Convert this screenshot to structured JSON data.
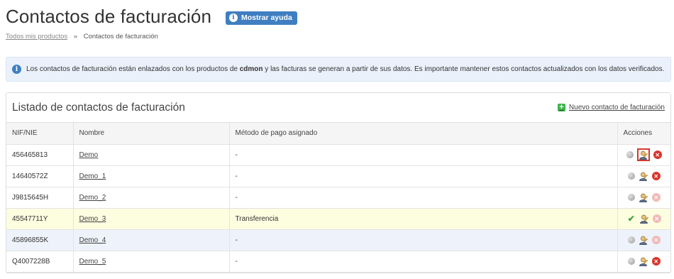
{
  "page": {
    "title": "Contactos de facturación",
    "help_button": "Mostrar ayuda"
  },
  "breadcrumb": {
    "root": "Todos mis productos",
    "separator": "»",
    "current": "Contactos de facturación"
  },
  "info": {
    "text_before": "Los contactos de facturación están enlazados con los productos de ",
    "brand": "cdmon",
    "text_after": " y las facturas se generan a partir de sus datos. Es importante mantener estos contactos actualizados con los datos verificados."
  },
  "panel": {
    "title": "Listado de contactos de facturación",
    "new_link": "Nuevo contacto de facturación"
  },
  "table": {
    "headers": [
      "NIF/NIE",
      "Nombre",
      "Método de pago asignado",
      "Acciones"
    ],
    "rows": [
      {
        "nif": "456465813",
        "name": "Demo",
        "payment": "-",
        "default": false,
        "delete_enabled": true,
        "edit_highlighted": true,
        "style": "normal"
      },
      {
        "nif": "14640572Z",
        "name": "Demo_1",
        "payment": "-",
        "default": false,
        "delete_enabled": true,
        "edit_highlighted": false,
        "style": "normal"
      },
      {
        "nif": "J9815645H",
        "name": "Demo_2",
        "payment": "-",
        "default": false,
        "delete_enabled": false,
        "edit_highlighted": false,
        "style": "normal"
      },
      {
        "nif": "45547711Y",
        "name": "Demo_3",
        "payment": "Transferencia",
        "default": true,
        "delete_enabled": false,
        "edit_highlighted": false,
        "style": "highlight"
      },
      {
        "nif": "45896855K",
        "name": "Demo_4",
        "payment": "-",
        "default": false,
        "delete_enabled": false,
        "edit_highlighted": false,
        "style": "soft"
      },
      {
        "nif": "Q4007228B",
        "name": "Demo_5",
        "payment": "-",
        "default": false,
        "delete_enabled": true,
        "edit_highlighted": false,
        "style": "normal"
      }
    ]
  },
  "icons": {
    "help": "info-icon",
    "info": "info-icon",
    "new": "plus-icon",
    "default_off": "grey-dot-icon",
    "default_on": "check-icon",
    "edit": "edit-contact-icon",
    "delete": "delete-icon"
  },
  "colors": {
    "accent": "#3f7fc1",
    "info_bg": "#eaf1fb",
    "highlight_row": "#fdfde0",
    "soft_row": "#eef3fb",
    "delete": "#d9342b",
    "success": "#3bb44a"
  }
}
